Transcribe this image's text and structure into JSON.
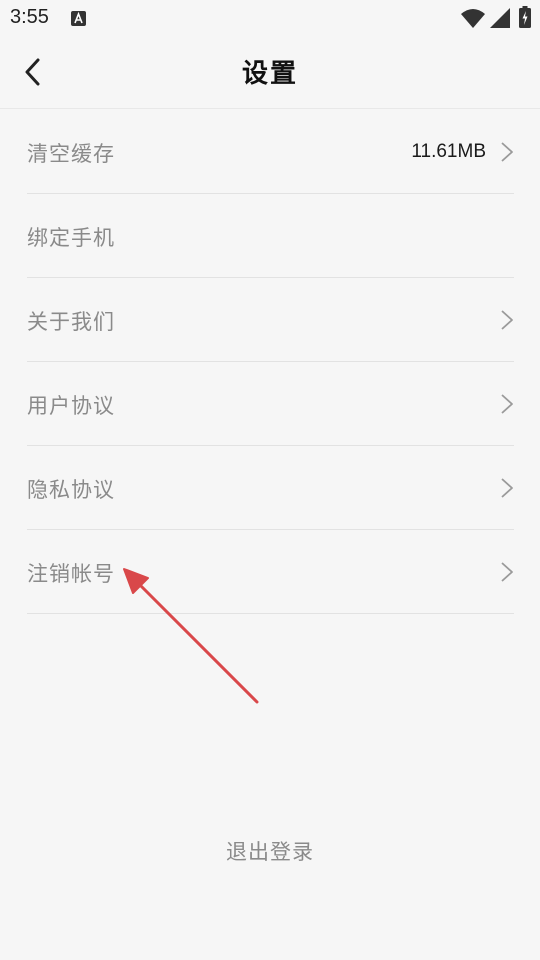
{
  "status_bar": {
    "time": "3:55",
    "notification_icon": "a-icon",
    "icons": [
      "wifi-icon",
      "signal-icon",
      "battery-icon"
    ]
  },
  "header": {
    "title": "设置",
    "back_icon": "chevron-left-icon"
  },
  "settings": {
    "items": [
      {
        "label": "清空缓存",
        "value": "11.61MB",
        "chevron": true
      },
      {
        "label": "绑定手机",
        "value": "",
        "chevron": false
      },
      {
        "label": "关于我们",
        "value": "",
        "chevron": true
      },
      {
        "label": "用户协议",
        "value": "",
        "chevron": true
      },
      {
        "label": "隐私协议",
        "value": "",
        "chevron": true
      },
      {
        "label": "注销帐号",
        "value": "",
        "chevron": true
      }
    ]
  },
  "annotation": {
    "type": "arrow",
    "color": "#d9484a",
    "points_to": "注销帐号"
  },
  "footer": {
    "logout_label": "退出登录"
  },
  "colors": {
    "background": "#f6f6f6",
    "label_text": "#8a8a8a",
    "divider": "#e2e2e2",
    "title_text": "#111111"
  }
}
